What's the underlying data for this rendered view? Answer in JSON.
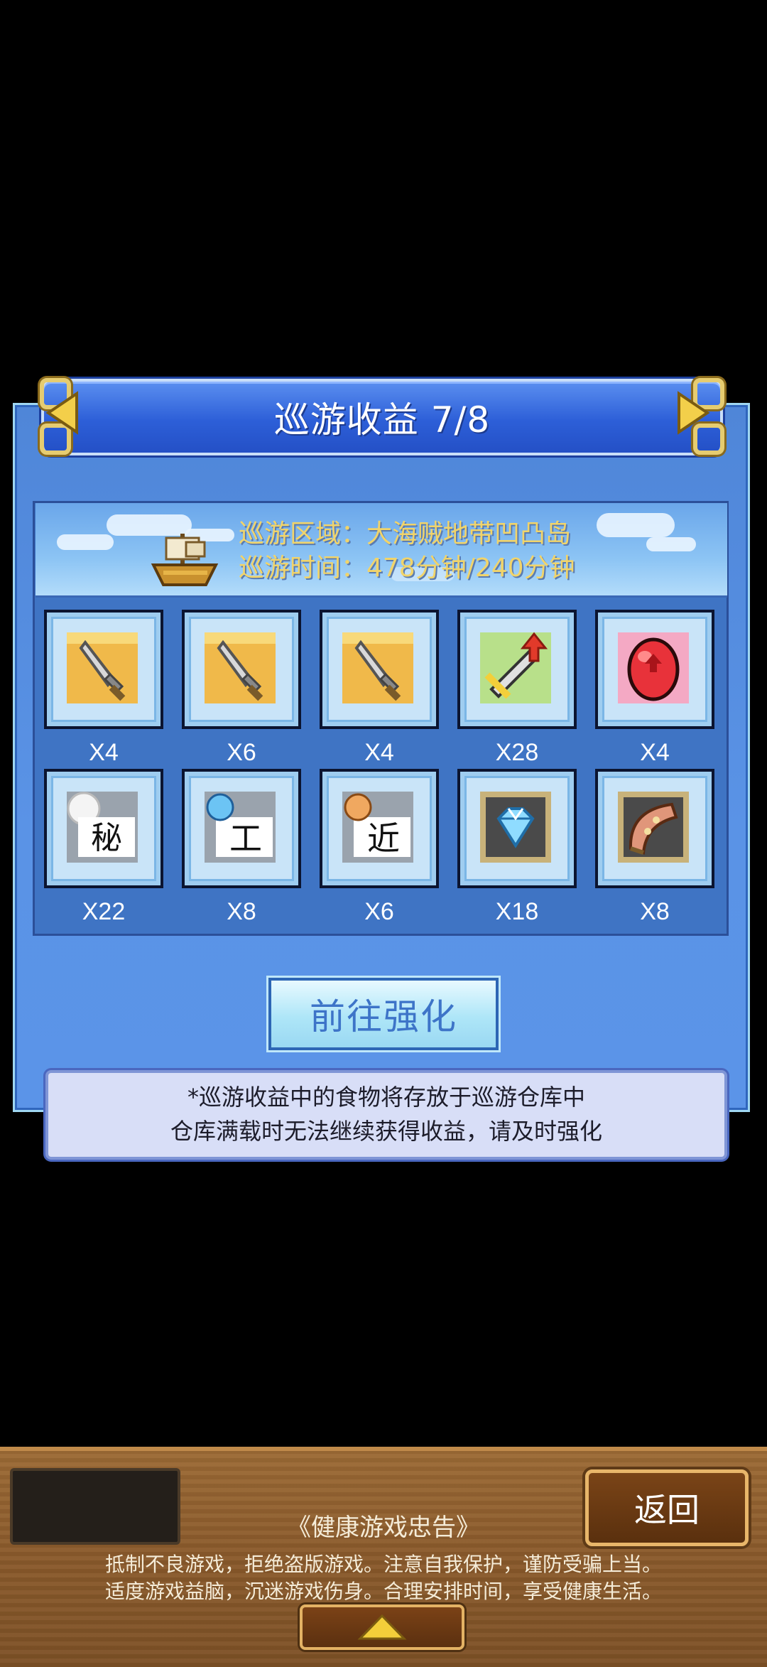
{
  "dialog": {
    "title": "巡游收益 7/8",
    "region_text": "巡游区域：大海贼地带凹凸岛",
    "time_text": "巡游时间：478分钟/240分钟"
  },
  "rewards": [
    {
      "icon": "dagger-icon",
      "qty": "X4"
    },
    {
      "icon": "dagger-icon",
      "qty": "X6"
    },
    {
      "icon": "dagger-icon",
      "qty": "X4"
    },
    {
      "icon": "sword-upgrade-icon",
      "qty": "X28"
    },
    {
      "icon": "red-egg-icon",
      "qty": "X4"
    },
    {
      "icon": "secret-scroll-icon",
      "qty": "X22"
    },
    {
      "icon": "craft-scroll-icon",
      "qty": "X8"
    },
    {
      "icon": "melee-scroll-icon",
      "qty": "X6"
    },
    {
      "icon": "diamond-icon",
      "qty": "X18"
    },
    {
      "icon": "fan-icon",
      "qty": "X8"
    }
  ],
  "go_button_label": "前往强化",
  "notice": {
    "line1": "*巡游收益中的食物将存放于巡游仓库中",
    "line2": "仓库满载时无法继续获得收益，请及时强化"
  },
  "bottom_bar": {
    "back_label": "返回",
    "health_title": "《健康游戏忠告》",
    "health_line1": "抵制不良游戏，拒绝盗版游戏。注意自我保护，谨防受骗上当。",
    "health_line2": "适度游戏益脑，沉迷游戏伤身。合理安排时间，享受健康生活。"
  },
  "colors": {
    "panel": "#5a93e6",
    "title_bar": "#2d5fd8",
    "info_text": "#f1d46a",
    "wood": "#8a5a2b"
  }
}
